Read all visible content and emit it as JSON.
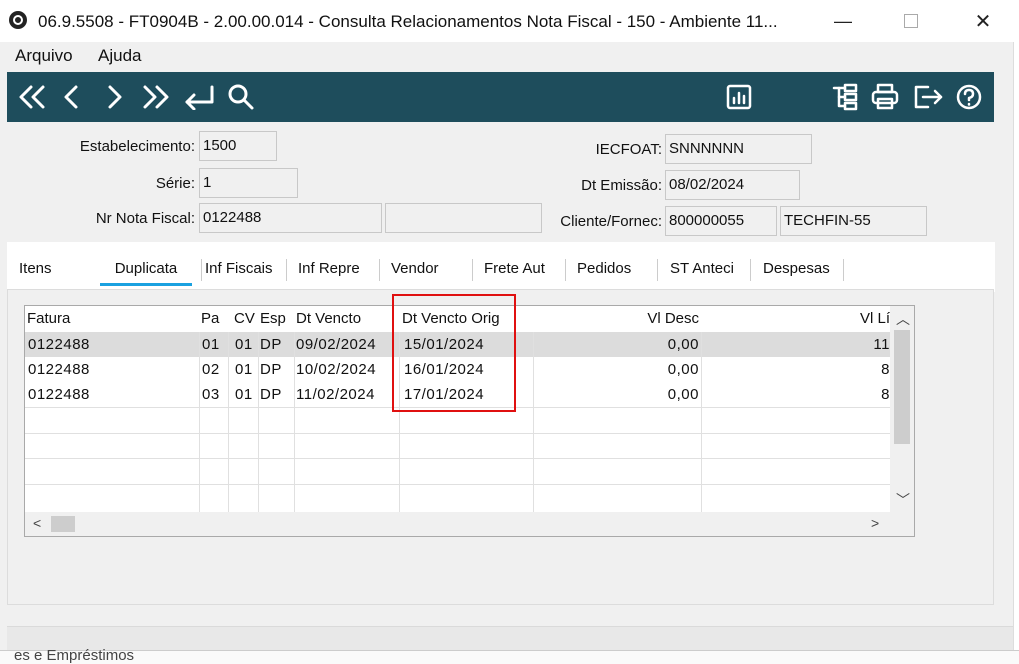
{
  "window": {
    "title": "06.9.5508 - FT0904B - 2.00.00.014 - Consulta Relacionamentos Nota Fiscal - 150 - Ambiente 11...",
    "minimize": "—",
    "close": "✕"
  },
  "menu": [
    "Arquivo",
    "Ajuda"
  ],
  "toolbar": {
    "icons": [
      "first-record-icon",
      "previous-record-icon",
      "next-record-icon",
      "last-record-icon",
      "return-icon",
      "search-icon",
      "report-icon",
      "structure-icon",
      "print-icon",
      "exit-icon",
      "help-icon"
    ]
  },
  "header": {
    "estabelecimento_label": "Estabelecimento:",
    "estabelecimento_value": "1500",
    "serie_label": "Série:",
    "serie_value": "1",
    "nr_nota_label": "Nr Nota Fiscal:",
    "nr_nota_value": "0122488",
    "nr_nota_extra": "",
    "iecfoat_label": "IECFOAT:",
    "iecfoat_value": "SNNNNNN",
    "dt_emissao_label": "Dt Emissão:",
    "dt_emissao_value": "08/02/2024",
    "cliente_label": "Cliente/Fornec:",
    "cliente_code": "800000055",
    "cliente_name": "TECHFIN-55"
  },
  "tabs": [
    "Itens",
    "Duplicata",
    "Inf Fiscais",
    "Inf Repre",
    "Vendor",
    "Frete Aut",
    "Pedidos",
    "ST Anteci",
    "Despesas"
  ],
  "active_tab": "Duplicata",
  "grid": {
    "columns": [
      "Fatura",
      "Pa",
      "CV",
      "Esp",
      "Dt Vencto",
      "Dt Vencto Orig",
      "Vl Desc",
      "Vl Lí"
    ],
    "rows": [
      [
        "0122488",
        "01",
        "01",
        "DP",
        "09/02/2024",
        "15/01/2024",
        "0,00",
        "11"
      ],
      [
        "0122488",
        "02",
        "01",
        "DP",
        "10/02/2024",
        "16/01/2024",
        "0,00",
        "8"
      ],
      [
        "0122488",
        "03",
        "01",
        "DP",
        "11/02/2024",
        "17/01/2024",
        "0,00",
        "8"
      ]
    ]
  },
  "background_text": "es e Empréstimos"
}
